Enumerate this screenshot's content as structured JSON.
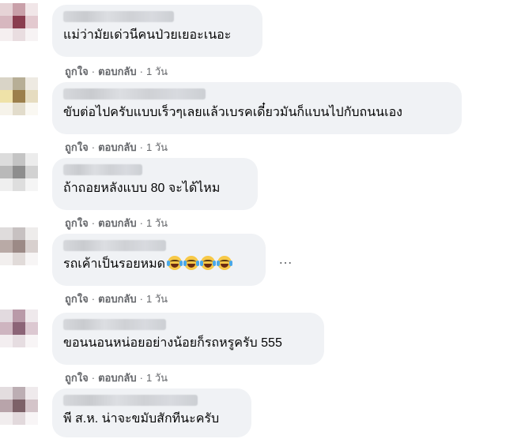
{
  "comments": [
    {
      "text": "แม่ว่ามัยเด่วนีคนป่วยเยอะเนอะ",
      "like": "ถูกใจ",
      "reply": "ตอบกลับ",
      "time": "1 วัน",
      "avatar_colors": [
        "#e6d3d6",
        "#c9a0a9",
        "#f1e6e8",
        "#d7b7bf",
        "#8a3d4f",
        "#e3c9cf",
        "#f5eff0",
        "#e9dde0",
        "#f7f3f4"
      ]
    },
    {
      "text": "ขับต่อไปครับแบบเร็วๆเลยแล้วเบรคเดี๋ยวมันก็แบนไปกับถนนเอง",
      "like": "ถูกใจ",
      "reply": "ตอบกลับ",
      "time": "1 วัน",
      "avatar_colors": [
        "#d9d4c7",
        "#b7ae96",
        "#eeeae2",
        "#efe2a8",
        "#9c7f4b",
        "#e6dcc0",
        "#f6f3ea",
        "#e2dccb",
        "#faf8f2"
      ]
    },
    {
      "text": "ถ้าถอยหลังแบบ 80 จะได้ไหม",
      "like": "ถูกใจ",
      "reply": "ตอบกลับ",
      "time": "1 วัน",
      "avatar_colors": [
        "#dcdcdc",
        "#c4c4c4",
        "#ececec",
        "#b9b9b9",
        "#8e8e8e",
        "#d2d2d2",
        "#efefef",
        "#dedede",
        "#f5f5f5"
      ]
    },
    {
      "text": "รถเค้าเป็นรอยหมด",
      "emoji_count": 4,
      "like": "ถูกใจ",
      "reply": "ตอบกลับ",
      "time": "1 วัน",
      "more_label": "…",
      "avatar_colors": [
        "#dfdcdc",
        "#c7c1c1",
        "#eeeceb",
        "#b9aaa6",
        "#9c8a86",
        "#d8d0ce",
        "#f2efee",
        "#e1dbd9",
        "#f7f5f5"
      ]
    },
    {
      "text": "ขอนนอนหน่อยอย่างน้อยก็รถหรูครับ 555",
      "like": "ถูกใจ",
      "reply": "ตอบกลับ",
      "time": "1 วัน",
      "avatar_colors": [
        "#e2dadf",
        "#b99aa8",
        "#efe9ec",
        "#ceb5c0",
        "#8c6477",
        "#dcc8d1",
        "#f3eef0",
        "#e6dde1",
        "#f8f5f6"
      ]
    },
    {
      "text": "พี ส.ห. น่าจะขมับสักทีนะครับ",
      "avatar_colors": [
        "#e3dddf",
        "#bcaeb3",
        "#efeaec",
        "#b8a4aa",
        "#7d6168",
        "#d4c4c9",
        "#f1edee",
        "#e2d9dc",
        "#f8f5f6"
      ]
    }
  ]
}
